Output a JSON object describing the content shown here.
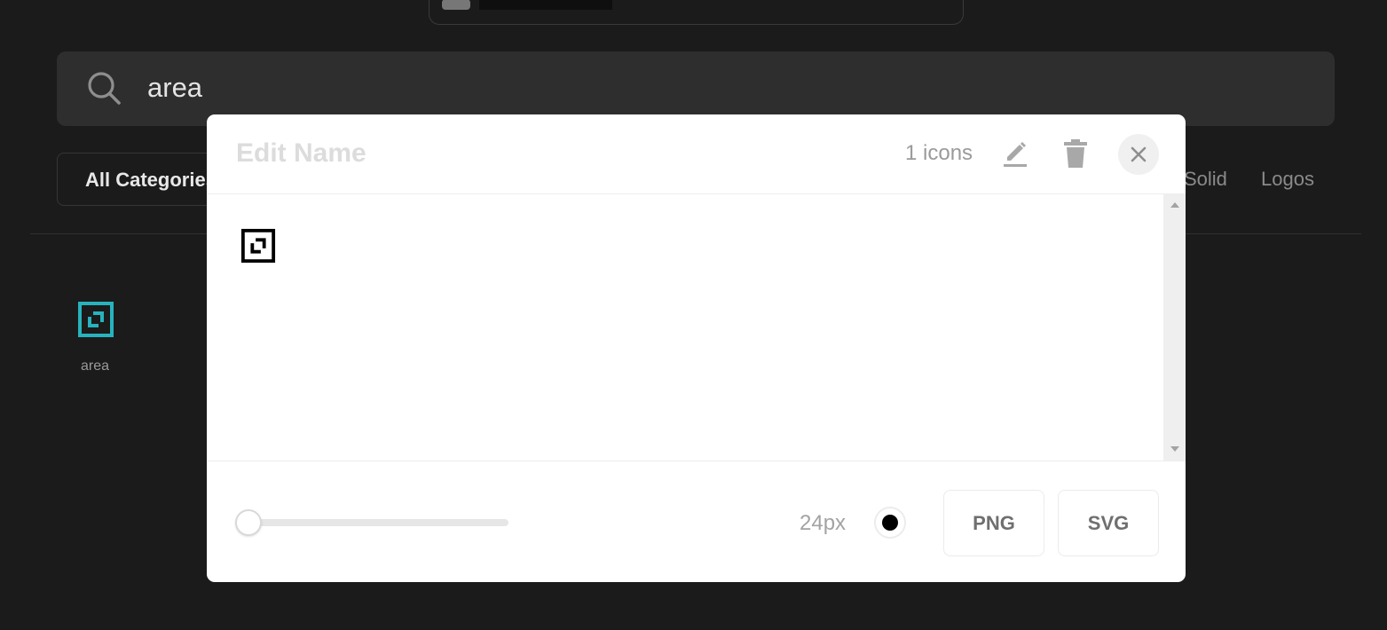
{
  "search": {
    "query": "area"
  },
  "categories": {
    "all_label": "All Categories",
    "tabs": [
      "Solid",
      "Logos"
    ]
  },
  "results": [
    {
      "label": "area",
      "icon": "area-icon"
    }
  ],
  "modal": {
    "title_placeholder": "Edit Name",
    "icon_count": "1 icons",
    "icons": [
      "edit-icon",
      "trash-icon",
      "close-icon"
    ],
    "size_label": "24px",
    "size_slider_value": 0,
    "color": "#000000",
    "buttons": {
      "png": "PNG",
      "svg": "SVG"
    }
  },
  "colors": {
    "background": "#1b1b1b",
    "search_bg": "#2e2e2e",
    "accent_teal": "#27b3bd"
  }
}
